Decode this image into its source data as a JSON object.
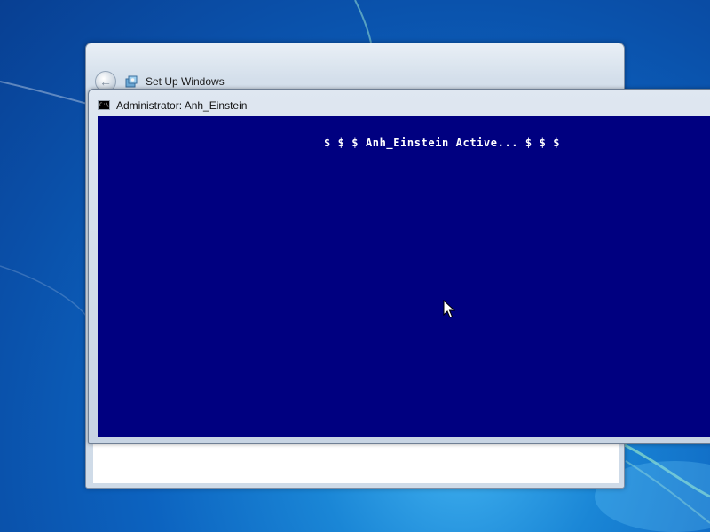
{
  "setup_window": {
    "title": "Set Up Windows",
    "back_icon": "back-arrow-icon",
    "app_icon": "setup-icon"
  },
  "console_window": {
    "title": "Administrator:  Anh_Einstein",
    "app_icon": "cmd-icon",
    "output_line": "$ $ $ Anh_Einstein Active... $ $ $",
    "background_color": "#000080",
    "text_color": "#ffffff"
  },
  "desktop": {
    "wallpaper_color": "#0c63c0"
  },
  "pointer": {
    "icon": "arrow-cursor-icon"
  }
}
